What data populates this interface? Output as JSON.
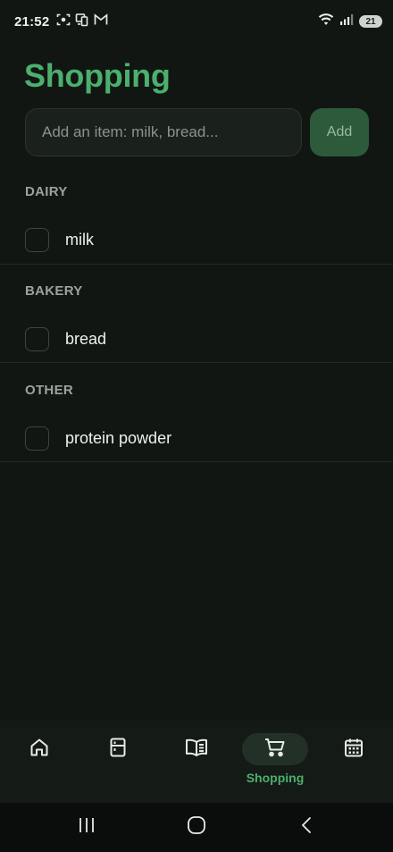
{
  "status_bar": {
    "time": "21:52",
    "battery_level": "21",
    "icons": [
      "screenshot-icon",
      "phone-link-icon",
      "gmail-icon",
      "wifi-icon",
      "signal-icon"
    ]
  },
  "page": {
    "title": "Shopping"
  },
  "add_item": {
    "placeholder": "Add an item: milk, bread...",
    "value": "",
    "button_label": "Add"
  },
  "sections": [
    {
      "header": "DAIRY",
      "items": [
        {
          "label": "milk",
          "checked": false
        }
      ]
    },
    {
      "header": "BAKERY",
      "items": [
        {
          "label": "bread",
          "checked": false
        }
      ]
    },
    {
      "header": "OTHER",
      "items": [
        {
          "label": "protein powder",
          "checked": false
        }
      ]
    }
  ],
  "bottom_nav": {
    "active": "Shopping",
    "items": [
      {
        "icon": "home-icon",
        "label": ""
      },
      {
        "icon": "fridge-icon",
        "label": ""
      },
      {
        "icon": "book-icon",
        "label": ""
      },
      {
        "icon": "cart-icon",
        "label": "Shopping"
      },
      {
        "icon": "calendar-icon",
        "label": ""
      }
    ]
  },
  "colors": {
    "accent": "#4caf6d",
    "background": "#111613",
    "add_button": "#2c5a3b"
  }
}
